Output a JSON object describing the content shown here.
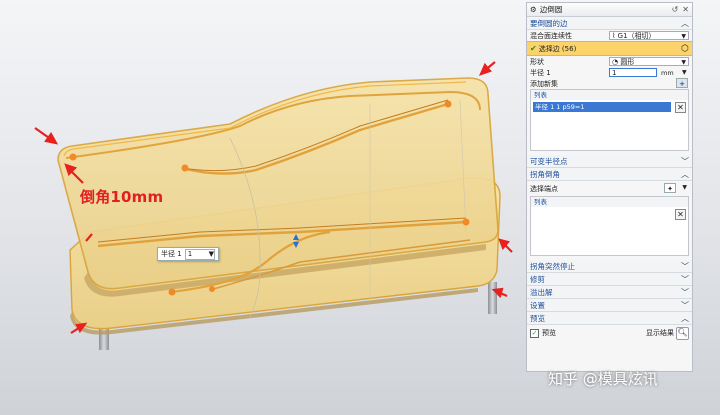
{
  "annotation": {
    "text": "倒角10mm"
  },
  "radius_popup": {
    "label": "半径 1",
    "value": "1",
    "arrow": "▼"
  },
  "panel": {
    "title": "边倒圆",
    "title_icon": "gear-icon",
    "section_edges": "要倒圆的边",
    "continuity_label": "混合面连续性",
    "continuity_value": "G1（相切）",
    "select_edge": "选择边 (56)",
    "shape_label": "形状",
    "shape_value": "圆形",
    "radius_label": "半径 1",
    "radius_value": "1",
    "radius_unit": "mm",
    "add_set": "添加新集",
    "list_header": "列表",
    "list_item": "半径 1   1   p59=1",
    "variable_radius": "可变半径点",
    "corner_setback": "拐角倒角",
    "select_vertex": "选择端点",
    "list_header2": "列表",
    "corner_stop": "拐角突然停止",
    "trim": "修剪",
    "overflow": "溢出解",
    "settings": "设置",
    "preview_section": "预览",
    "preview_label": "预览",
    "show_result": "显示结果"
  },
  "watermark": "知乎 @模具炫讯"
}
